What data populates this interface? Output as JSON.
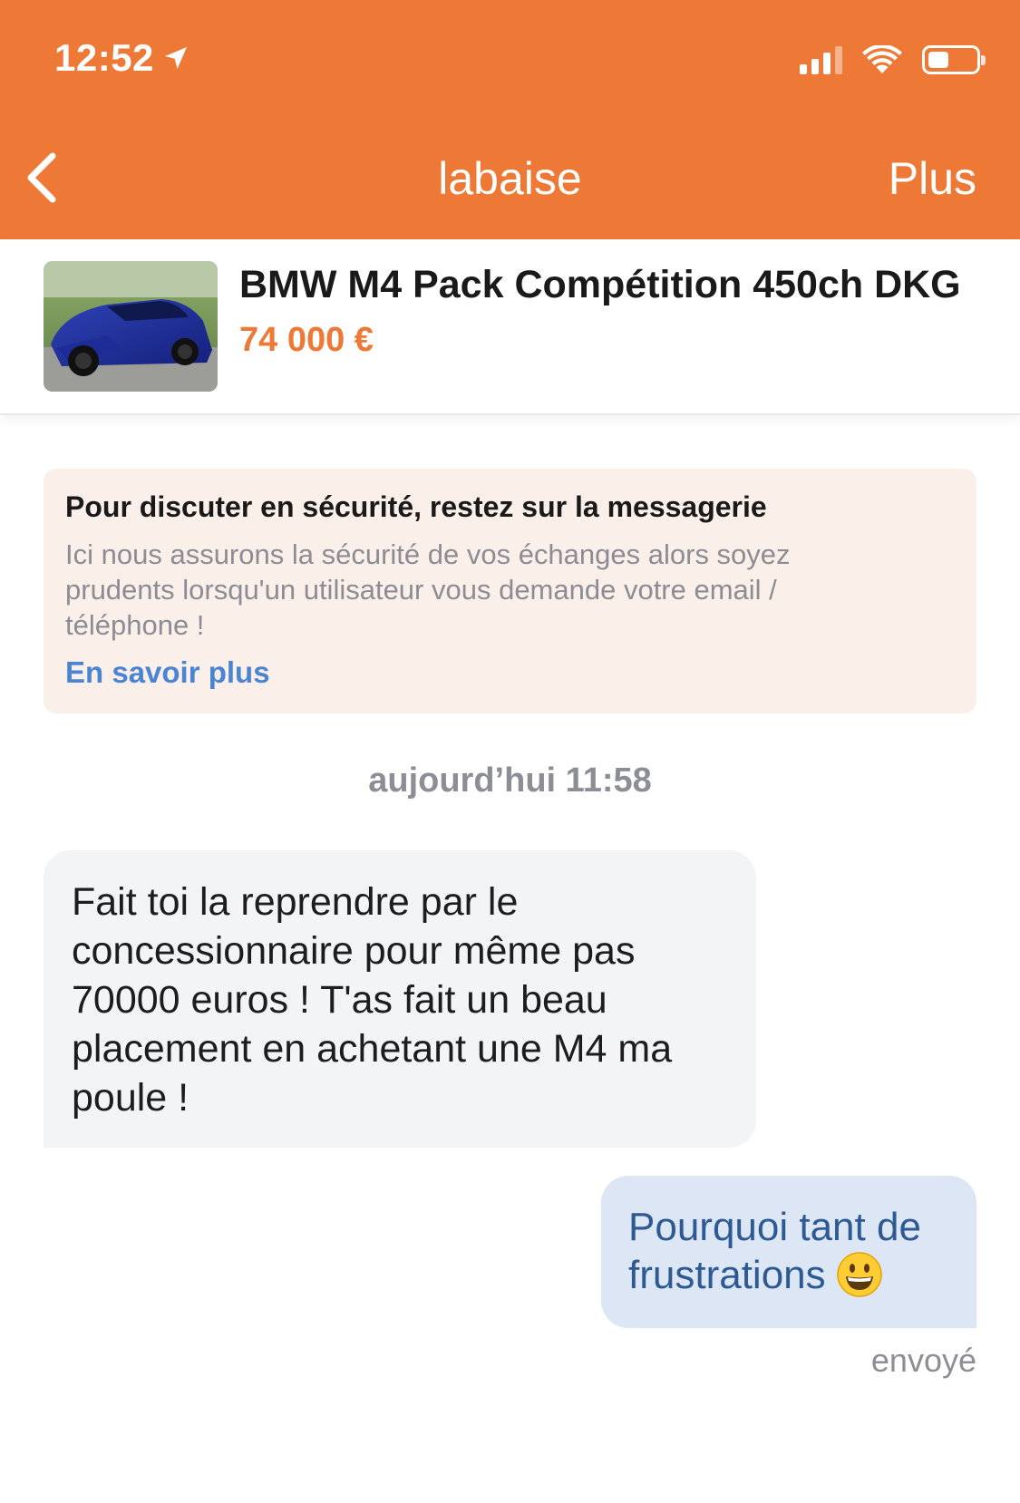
{
  "status_bar": {
    "time": "12:52"
  },
  "nav": {
    "title": "labaise",
    "more_label": "Plus"
  },
  "listing": {
    "title": "BMW M4 Pack Compétition 450ch DKG",
    "price": "74 000 €"
  },
  "safety_notice": {
    "title": "Pour discuter en sécurité, restez sur la messagerie",
    "body": "Ici nous assurons la sécurité de vos échanges alors soyez prudents lorsqu'un utilisateur vous demande votre email / téléphone !",
    "link_label": "En savoir plus"
  },
  "conversation": {
    "date_separator": "aujourd’hui 11:58",
    "messages": [
      {
        "direction": "received",
        "text": "Fait toi la reprendre par le concessionnaire pour même pas 70000 euros ! T'as fait un beau placement en achetant une M4 ma poule !"
      },
      {
        "direction": "sent",
        "text": "Pourquoi tant de frustrations",
        "status": "envoyé"
      }
    ]
  },
  "colors": {
    "brand": "#EE7835",
    "link": "#4A84D2",
    "notice_bg": "#FBEFEA",
    "bubble_received_bg": "#F3F4F6",
    "bubble_sent_bg": "#DCE6F4",
    "bubble_sent_text": "#2E5A94"
  },
  "icons": [
    "location-arrow-icon",
    "cellular-signal-icon",
    "wifi-icon",
    "battery-icon",
    "back-chevron-icon",
    "grinning-face-emoji"
  ]
}
